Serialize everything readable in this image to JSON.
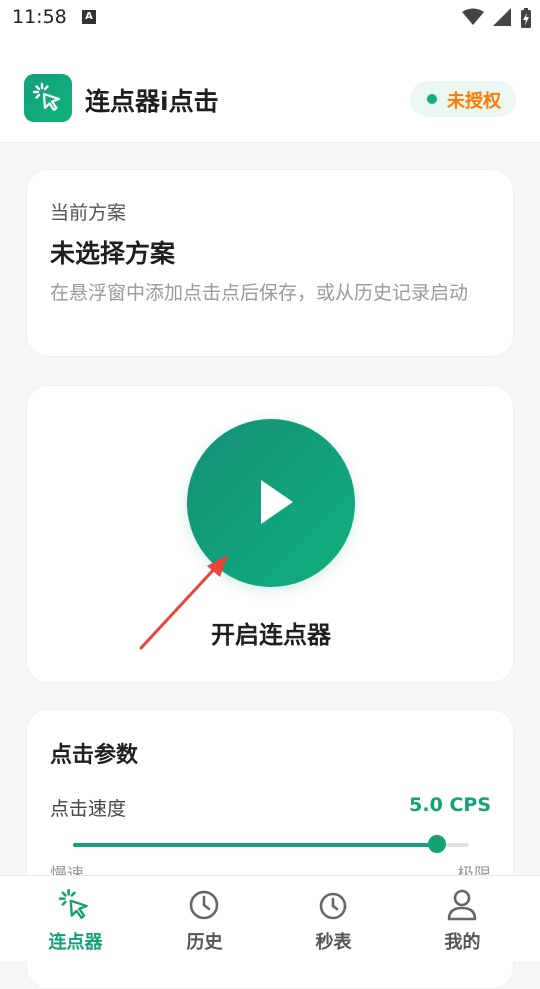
{
  "status_bar": {
    "time": "11:58",
    "notification_badge": "A"
  },
  "header": {
    "app_title": "连点器i点击",
    "license_status": "未授权",
    "license_color": "#ff7a00",
    "accent_color": "#12a274"
  },
  "scheme": {
    "label": "当前方案",
    "name": "未选择方案",
    "hint": "在悬浮窗中添加点击点后保存，或从历史记录启动"
  },
  "start": {
    "label": "开启连点器",
    "icon": "play-icon"
  },
  "params": {
    "title": "点击参数",
    "speed_label": "点击速度",
    "speed_value": "5.0 CPS",
    "slider_level": 0.92,
    "slider_min_label": "慢速",
    "slider_max_label": "极限"
  },
  "nav": {
    "items": [
      {
        "label": "连点器",
        "icon": "cursor-click-icon",
        "active": true
      },
      {
        "label": "历史",
        "icon": "clock-icon",
        "active": false
      },
      {
        "label": "秒表",
        "icon": "stopwatch-icon",
        "active": false
      },
      {
        "label": "我的",
        "icon": "user-icon",
        "active": false
      }
    ]
  }
}
